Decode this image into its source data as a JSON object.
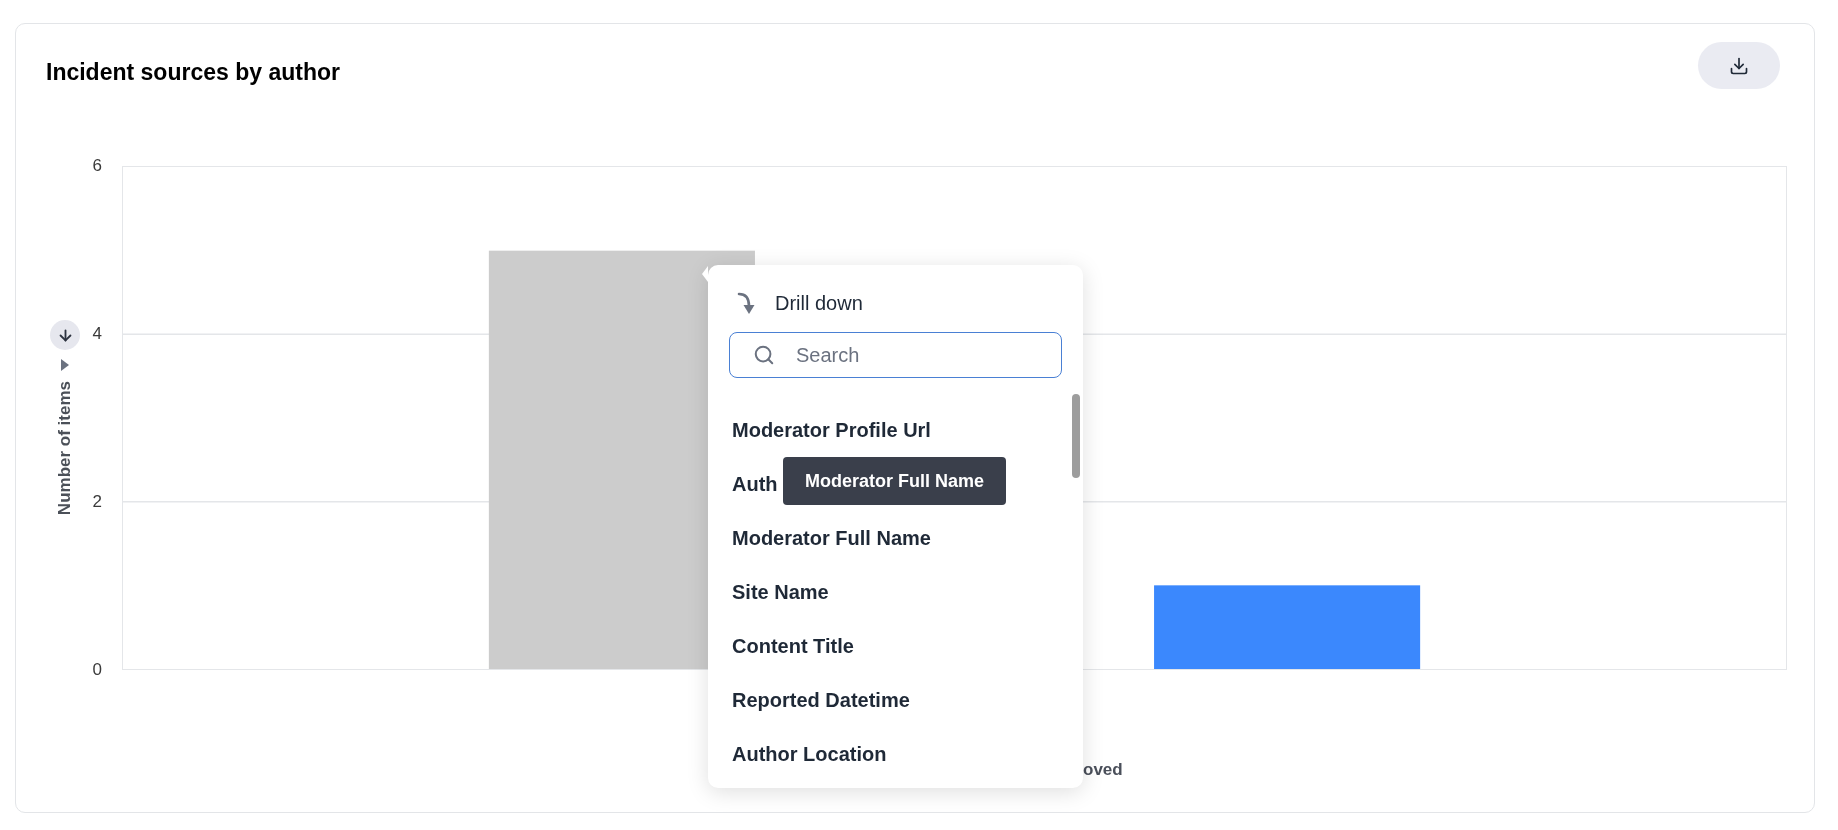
{
  "card": {
    "title": "Incident sources by author"
  },
  "chart": {
    "chart_data": {
      "type": "bar",
      "xlabel": "oved",
      "ylabel": "Number of items",
      "ylim": [
        0,
        6
      ],
      "yticks": [
        0,
        2,
        4,
        6
      ],
      "series": [
        {
          "values": [
            5,
            1
          ]
        }
      ]
    },
    "bars": [
      {
        "color": "#cccccc"
      },
      {
        "color": "#3b88fd"
      }
    ]
  },
  "drilldown": {
    "title": "Drill down",
    "search": {
      "placeholder": "Search"
    },
    "items": [
      {
        "label": "Moderator Profile Url"
      },
      {
        "label": "Auth"
      },
      {
        "label": "Moderator Full Name"
      },
      {
        "label": "Site Name"
      },
      {
        "label": "Content Title"
      },
      {
        "label": "Reported Datetime"
      },
      {
        "label": "Author Location"
      }
    ]
  },
  "tooltip": {
    "text": "Moderator Full Name"
  }
}
